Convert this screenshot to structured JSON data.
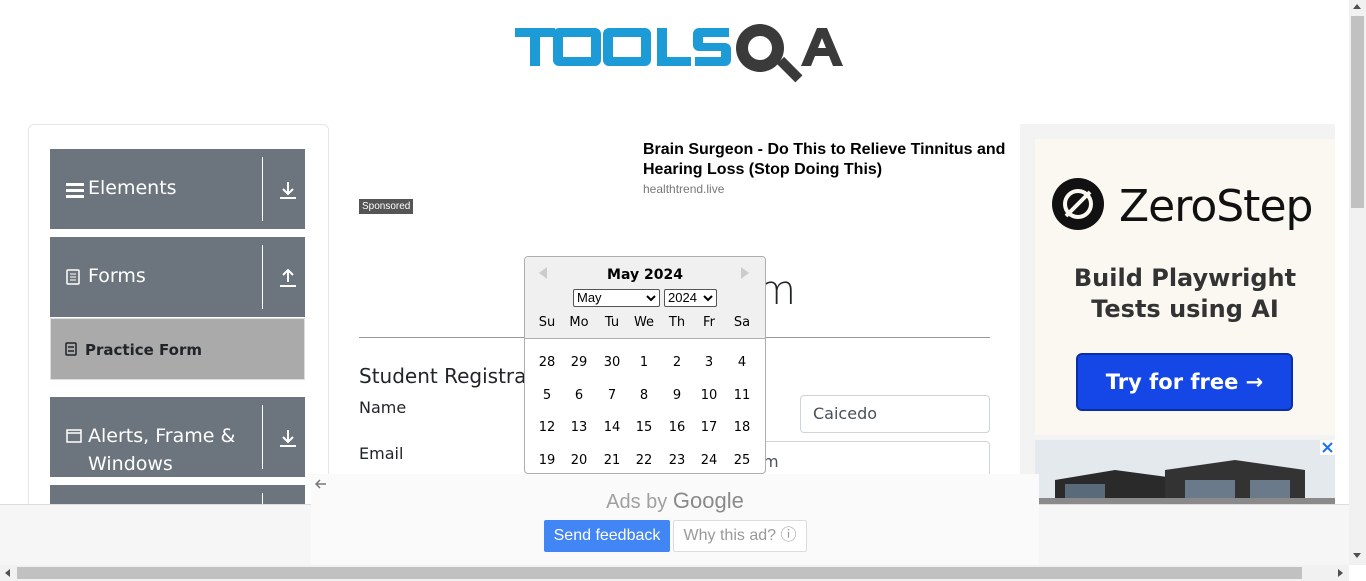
{
  "logo": {
    "text": "TOOLSQA",
    "primary_color": "#1d9bd7",
    "dark_color": "#3a3a3a"
  },
  "sidebar": {
    "groups": [
      {
        "label": "Elements",
        "icon": "list-icon",
        "arrow": "download-arrow-icon"
      },
      {
        "label": "Forms",
        "icon": "document-icon",
        "arrow": "upload-arrow-icon"
      },
      {
        "label": "Alerts, Frame & Windows",
        "icon": "window-icon",
        "arrow": "download-arrow-icon"
      }
    ],
    "active_item": {
      "label": "Practice Form",
      "icon": "form-icon"
    }
  },
  "sponsored_ad": {
    "badge": "Sponsored",
    "title": "Brain Surgeon - Do This to Relieve Tinnitus and Hearing Loss (Stop Doing This)",
    "domain": "healthtrend.live"
  },
  "main": {
    "heading_tail": "m",
    "form_title": "Student Registration Form",
    "name_label": "Name",
    "email_label": "Email",
    "last_name_value": "Caicedo",
    "email_value_tail": "m"
  },
  "datepicker": {
    "title": "May 2024",
    "month_select": "May",
    "year_select": "2024",
    "weekdays": [
      "Su",
      "Mo",
      "Tu",
      "We",
      "Th",
      "Fr",
      "Sa"
    ],
    "weeks": [
      [
        "28",
        "29",
        "30",
        "1",
        "2",
        "3",
        "4"
      ],
      [
        "5",
        "6",
        "7",
        "8",
        "9",
        "10",
        "11"
      ],
      [
        "12",
        "13",
        "14",
        "15",
        "16",
        "17",
        "18"
      ],
      [
        "19",
        "20",
        "21",
        "22",
        "23",
        "24",
        "25"
      ]
    ]
  },
  "right_ad": {
    "brand": "ZeroStep",
    "tagline_line1": "Build Playwright",
    "tagline_line2": "Tests using AI",
    "cta": "Try for free →",
    "cta_color": "#1447e6"
  },
  "google_ads": {
    "label_prefix": "Ads by",
    "label_brand": "Google",
    "send_feedback": "Send feedback",
    "why_this_ad": "Why this ad? ⓘ"
  }
}
